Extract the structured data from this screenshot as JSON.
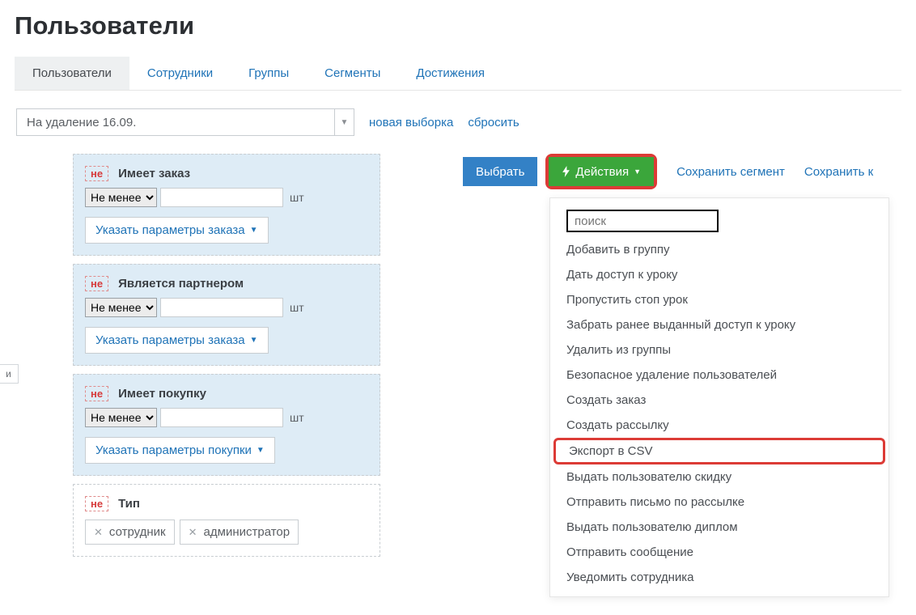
{
  "page": {
    "title": "Пользователи"
  },
  "tabs": [
    "Пользователи",
    "Сотрудники",
    "Группы",
    "Сегменты",
    "Достижения"
  ],
  "active_tab_index": 0,
  "filter_bar": {
    "selected": "На удаление 16.09.",
    "new_selection": "новая выборка",
    "reset": "сбросить"
  },
  "and_label": "и",
  "not_label": "не",
  "unit_label": "шт",
  "select_option": "Не менее",
  "filter_cards": [
    {
      "title": "Имеет заказ",
      "blue": true,
      "param_btn": "Указать параметры заказа",
      "has_inputs": true
    },
    {
      "title": "Является партнером",
      "blue": true,
      "param_btn": "Указать параметры заказа",
      "has_inputs": true
    },
    {
      "title": "Имеет покупку",
      "blue": true,
      "param_btn": "Указать параметры покупки",
      "has_inputs": true
    },
    {
      "title": "Тип",
      "blue": false,
      "tags": [
        "сотрудник",
        "администратор"
      ]
    }
  ],
  "actions_bar": {
    "select_btn": "Выбрать",
    "actions_btn": "Действия",
    "save_segment": "Сохранить сегмент",
    "save_next": "Сохранить к"
  },
  "dropdown": {
    "search_placeholder": "поиск",
    "items": [
      "Добавить в группу",
      "Дать доступ к уроку",
      "Пропустить стоп урок",
      "Забрать ранее выданный доступ к уроку",
      "Удалить из группы",
      "Безопасное удаление пользователей",
      "Создать заказ",
      "Создать рассылку",
      "Экспорт в CSV",
      "Выдать пользователю скидку",
      "Отправить письмо по рассылке",
      "Выдать пользователю диплом",
      "Отправить сообщение",
      "Уведомить сотрудника"
    ],
    "highlighted_index": 8
  }
}
